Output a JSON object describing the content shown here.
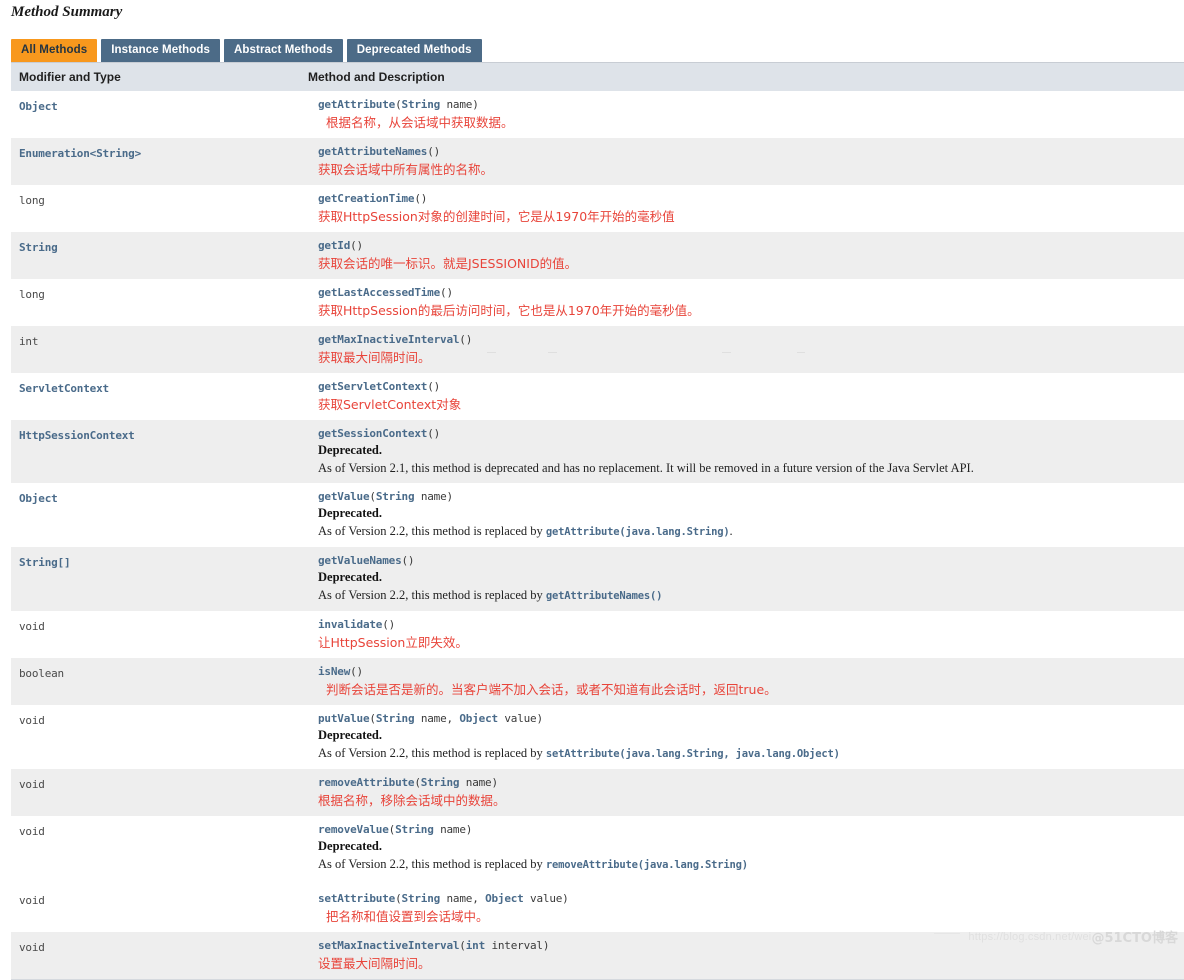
{
  "title": "Method Summary",
  "tabs": [
    {
      "label": "All Methods",
      "active": true
    },
    {
      "label": "Instance Methods",
      "active": false
    },
    {
      "label": "Abstract Methods",
      "active": false
    },
    {
      "label": "Deprecated Methods",
      "active": false
    }
  ],
  "columns": {
    "modifier": "Modifier and Type",
    "description": "Method and Description"
  },
  "rows": [
    {
      "type": "Object",
      "type_kind": "link",
      "signature": "getAttribute(String  name)",
      "note": "根据名称，从会话域中获取数据。",
      "note_kind": "cn",
      "note_indent": true
    },
    {
      "type": "Enumeration<String>",
      "type_kind": "link",
      "signature": "getAttributeNames()",
      "note": "获取会话域中所有属性的名称。",
      "note_kind": "cn"
    },
    {
      "type": "long",
      "type_kind": "prim",
      "signature": "getCreationTime()",
      "note": "获取HttpSession对象的创建时间，它是从1970年开始的毫秒值",
      "note_kind": "cn"
    },
    {
      "type": "String",
      "type_kind": "link",
      "signature": "getId()",
      "note": "获取会话的唯一标识。就是JSESSIONID的值。",
      "note_kind": "cn"
    },
    {
      "type": "long",
      "type_kind": "prim",
      "signature": "getLastAccessedTime()",
      "note": "获取HttpSession的最后访问时间，它也是从1970年开始的毫秒值。",
      "note_kind": "cn"
    },
    {
      "type": "int",
      "type_kind": "prim",
      "signature": "getMaxInactiveInterval()",
      "note": "获取最大间隔时间。",
      "note_kind": "cn"
    },
    {
      "type": "ServletContext",
      "type_kind": "link",
      "signature": "getServletContext()",
      "note": "获取ServletContext对象",
      "note_kind": "cn"
    },
    {
      "type": "HttpSessionContext",
      "type_kind": "link",
      "signature": "getSessionContext()",
      "note_kind": "deprecated",
      "deprecated_label": "Deprecated.",
      "deprecated_text": "As of Version 2.1, this method is deprecated and has no replacement. It will be removed in a future version of the Java Servlet API.",
      "deprecated_code": "",
      "deprecated_tail": ""
    },
    {
      "type": "Object",
      "type_kind": "link",
      "signature": "getValue(String  name)",
      "note_kind": "deprecated",
      "deprecated_label": "Deprecated.",
      "deprecated_text": "As of Version 2.2, this method is replaced by ",
      "deprecated_code": "getAttribute(java.lang.String)",
      "deprecated_tail": "."
    },
    {
      "type": "String[]",
      "type_kind": "link",
      "signature": "getValueNames()",
      "note_kind": "deprecated",
      "deprecated_label": "Deprecated.",
      "deprecated_text": "As of Version 2.2, this method is replaced by ",
      "deprecated_code": "getAttributeNames()",
      "deprecated_tail": ""
    },
    {
      "type": "void",
      "type_kind": "prim",
      "signature": "invalidate()",
      "note": "让HttpSession立即失效。",
      "note_kind": "cn"
    },
    {
      "type": "boolean",
      "type_kind": "prim",
      "signature": "isNew()",
      "note": "判断会话是否是新的。当客户端不加入会话，或者不知道有此会话时，返回true。",
      "note_kind": "cn",
      "note_indent": true
    },
    {
      "type": "void",
      "type_kind": "prim",
      "signature": "putValue(String  name, Object  value)",
      "note_kind": "deprecated",
      "deprecated_label": "Deprecated.",
      "deprecated_text": "As of Version 2.2, this method is replaced by ",
      "deprecated_code": "setAttribute(java.lang.String,  java.lang.Object)",
      "deprecated_tail": ""
    },
    {
      "type": "void",
      "type_kind": "prim",
      "signature": "removeAttribute(String  name)",
      "note": "根据名称，移除会话域中的数据。",
      "note_kind": "cn"
    },
    {
      "type": "void",
      "type_kind": "prim",
      "signature": "removeValue(String  name)",
      "note_kind": "deprecated",
      "deprecated_label": "Deprecated.",
      "deprecated_text": "As of Version 2.2, this method is replaced by ",
      "deprecated_code": "removeAttribute(java.lang.String)",
      "deprecated_tail": ""
    }
  ],
  "rows_lower": [
    {
      "type": "void",
      "type_kind": "prim",
      "signature": "setAttribute(String  name, Object  value)",
      "note": "把名称和值设置到会话域中。",
      "note_kind": "cn",
      "note_indent": true
    },
    {
      "type": "void",
      "type_kind": "prim",
      "signature": "setMaxInactiveInterval(int  interval)",
      "note": "设置最大间隔时间。",
      "note_kind": "cn"
    }
  ],
  "watermark": {
    "url": "https://blog.csdn.net/wei",
    "brand": "@51CTO博客"
  },
  "colors": {
    "tab_active": "#f8981d",
    "tab_inactive": "#4c6b87",
    "header_band": "#dee3e9",
    "row_alt": "#eeeeee",
    "link": "#4a6b8a",
    "note": "#e8443a"
  }
}
